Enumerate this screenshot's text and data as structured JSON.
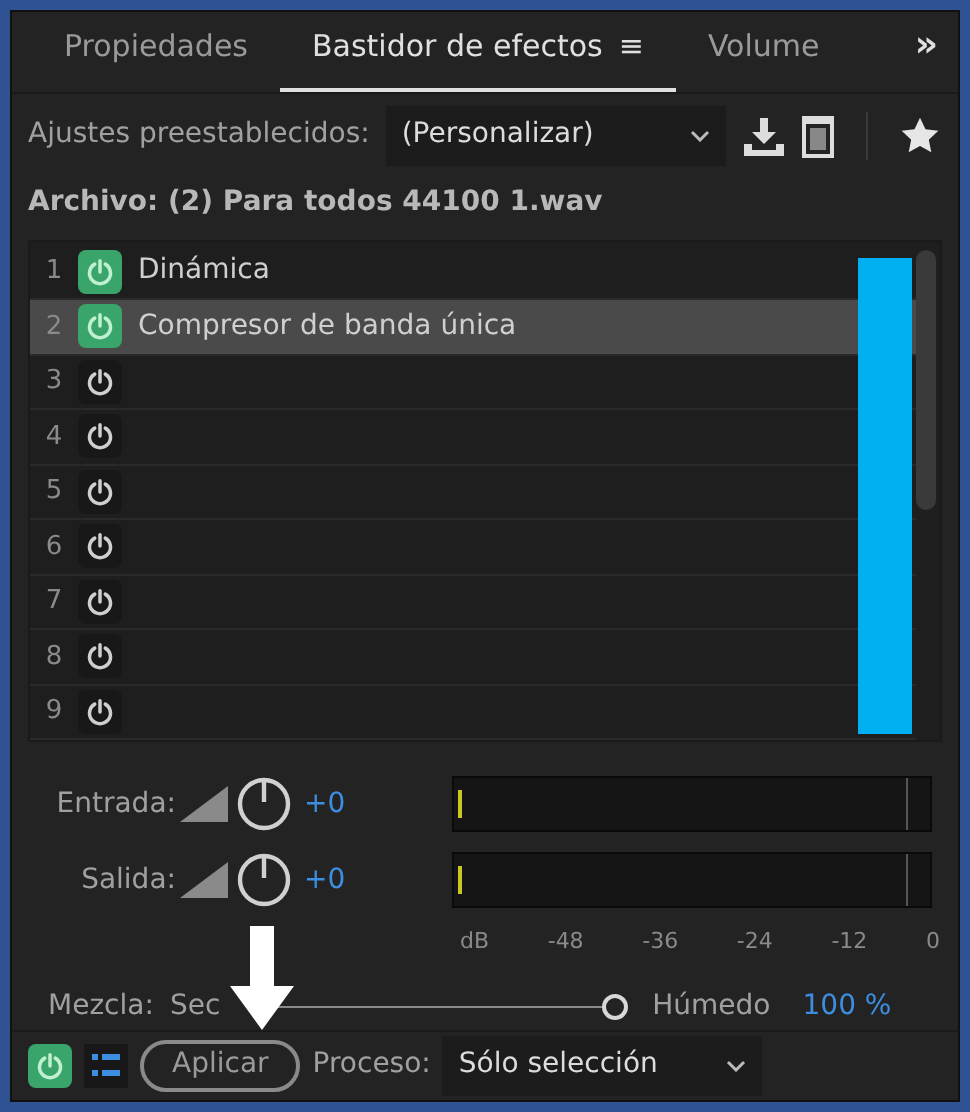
{
  "tabs": [
    {
      "label": "Propiedades",
      "selected": false
    },
    {
      "label": "Bastidor de efectos",
      "selected": true,
      "menu": "≡"
    },
    {
      "label": "Volume",
      "selected": false
    }
  ],
  "overflow": "»",
  "presets": {
    "label": "Ajustes preestablecidos:",
    "value": "(Personalizar)"
  },
  "file": "Archivo: (2) Para todos 44100 1.wav",
  "effects": [
    {
      "number": "1",
      "on": true,
      "name": "Dinámica",
      "selected": false
    },
    {
      "number": "2",
      "on": true,
      "name": "Compresor de banda única",
      "selected": true
    },
    {
      "number": "3",
      "on": false,
      "selected": false
    },
    {
      "number": "4",
      "on": false,
      "selected": false
    },
    {
      "number": "5",
      "on": false,
      "selected": false
    },
    {
      "number": "6",
      "on": false,
      "selected": false
    },
    {
      "number": "7",
      "on": false,
      "selected": false
    },
    {
      "number": "8",
      "on": false,
      "selected": false
    },
    {
      "number": "9",
      "on": false,
      "selected": false
    }
  ],
  "gains": [
    {
      "label": "Entrada:",
      "value": "+0"
    },
    {
      "label": "Salida:",
      "value": "+0"
    }
  ],
  "scale": [
    "dB",
    "-48",
    "-36",
    "-24",
    "-12",
    "0"
  ],
  "mix": {
    "label": "Mezcla:",
    "left": "Sec",
    "right": "Húmedo",
    "value": "100 %",
    "level": 1
  },
  "footer": {
    "power_on": true,
    "apply": "Aplicar",
    "process_label": "Proceso:",
    "process_value": "Sólo selección"
  }
}
